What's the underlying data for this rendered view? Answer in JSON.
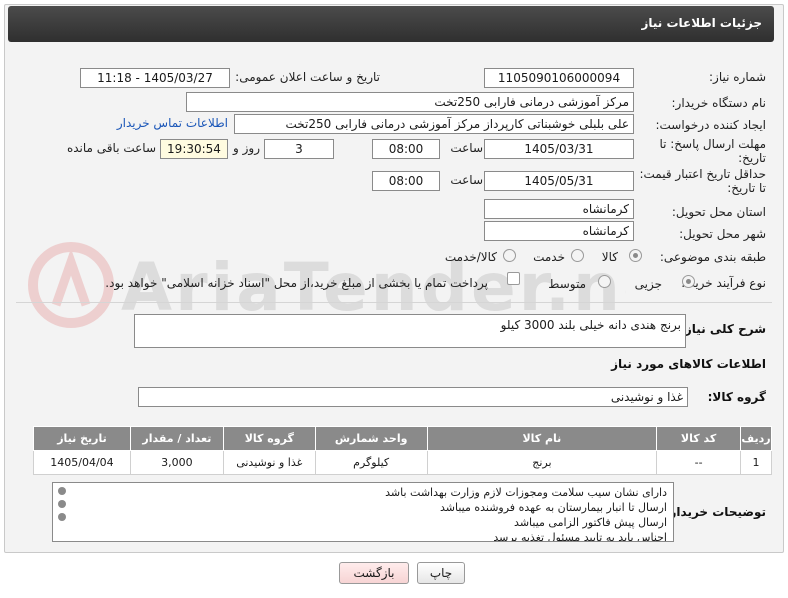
{
  "header": {
    "title": "جزئیات اطلاعات نیاز"
  },
  "fields": {
    "need_number_label": "شماره نیاز:",
    "need_number": "1105090106000094",
    "announce_label": "تاریخ و ساعت اعلان عمومی:",
    "announce_value": "1405/03/27 - 11:18",
    "buyer_org_label": "نام دستگاه خریدار:",
    "buyer_org": "مرکز آموزشی  درمانی فارابی 250تخت",
    "creator_label": "ایجاد کننده درخواست:",
    "creator": "علی بلبلی خوشبناتی کارپرداز مرکز آموزشی  درمانی فارابی 250تخت",
    "contact_link": "اطلاعات تماس خریدار",
    "deadline_label": "مهلت ارسال پاسخ: تا تاریخ:",
    "deadline_date": "1405/03/31",
    "time_label": "ساعت",
    "deadline_time": "08:00",
    "days_value": "3",
    "days_label": "روز و",
    "remaining_time": "19:30:54",
    "remaining_label": "ساعت باقی مانده",
    "validity_label": "حداقل تاریخ اعتبار قیمت: تا تاریخ:",
    "validity_date": "1405/05/31",
    "validity_time_label": "ساعت",
    "validity_time": "08:00",
    "province_label": "استان محل تحویل:",
    "province": "کرمانشاه",
    "city_label": "شهر محل تحویل:",
    "city": "کرمانشاه",
    "category_label": "طبقه بندی موضوعی:",
    "category_options": [
      "کالا",
      "خدمت",
      "کالا/خدمت"
    ],
    "process_label": "نوع فرآیند خرید :",
    "process_options": [
      "جزیی",
      "متوسط"
    ],
    "payment_note": "پرداخت تمام یا بخشی از مبلغ خرید،از محل \"اسناد خزانه اسلامی\" خواهد بود."
  },
  "description": {
    "label": "شرح کلی نیاز:",
    "value": "برنج هندی دانه خیلی بلند 3000 کیلو"
  },
  "goods_section": {
    "title": "اطلاعات کالاهای مورد نیاز",
    "group_label": "گروه کالا:",
    "group_value": "غذا و نوشیدنی"
  },
  "table": {
    "headers": [
      "ردیف",
      "کد کالا",
      "نام کالا",
      "واحد شمارش",
      "گروه کالا",
      "تعداد / مقدار",
      "تاریخ نیاز"
    ],
    "rows": [
      [
        "1",
        "--",
        "برنج",
        "کیلوگرم",
        "غذا و نوشیدنی",
        "3,000",
        "1405/04/04"
      ]
    ]
  },
  "buyer_notes": {
    "label": "توضیحات خریدار:",
    "lines": [
      "دارای نشان سیب سلامت ومجوزات لازم وزارت بهداشت  باشد",
      "ارسال تا انبار بیمارستان به عهده فروشنده میباشد",
      "ارسال پیش فاکتور الزامی میباشد",
      "اجناس باید به تایید مسئول تغذیه برسد"
    ]
  },
  "buttons": {
    "print": "چاپ",
    "back": "بازگشت"
  },
  "watermark": "AriaTender.net",
  "colors": {
    "header_bg": "#3a3a3a",
    "table_header_bg": "#8a8a8a",
    "link": "#1a56b8"
  }
}
